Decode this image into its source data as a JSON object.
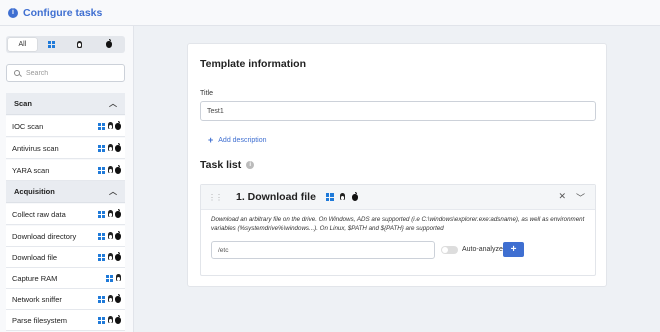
{
  "header": {
    "title": "Configure tasks",
    "icon": "info-icon"
  },
  "sidebar": {
    "os_filter": {
      "all_label": "All"
    },
    "search": {
      "placeholder": "Search"
    },
    "groups": [
      {
        "label": "Scan",
        "items": [
          {
            "label": "IOC scan"
          },
          {
            "label": "Antivirus scan"
          },
          {
            "label": "YARA scan"
          }
        ]
      },
      {
        "label": "Acquisition",
        "items": [
          {
            "label": "Collect raw data"
          },
          {
            "label": "Download directory"
          },
          {
            "label": "Download file"
          },
          {
            "label": "Capture RAM"
          },
          {
            "label": "Network sniffer"
          },
          {
            "label": "Parse filesystem"
          }
        ]
      }
    ]
  },
  "main": {
    "template_title": "Template information",
    "title_field": {
      "label": "Title",
      "value": "Test1"
    },
    "add_description_label": "Add description",
    "task_list_title": "Task list",
    "task": {
      "name": "1. Download file",
      "description": "Download an arbitrary file on the drive. On Windows, ADS are supported (i.e C:\\windows\\explorer.exe:adsname), as well as environment variables (%systemdrive%\\windows...). On Linux, $PATH and ${PATH} are supported",
      "path_value": "/etc",
      "auto_analyze_label": "Auto-analyze",
      "auto_analyze": false,
      "add_label": "+"
    }
  },
  "colors": {
    "accent": "#3f6fd1",
    "windows": "#1f7ad9"
  }
}
